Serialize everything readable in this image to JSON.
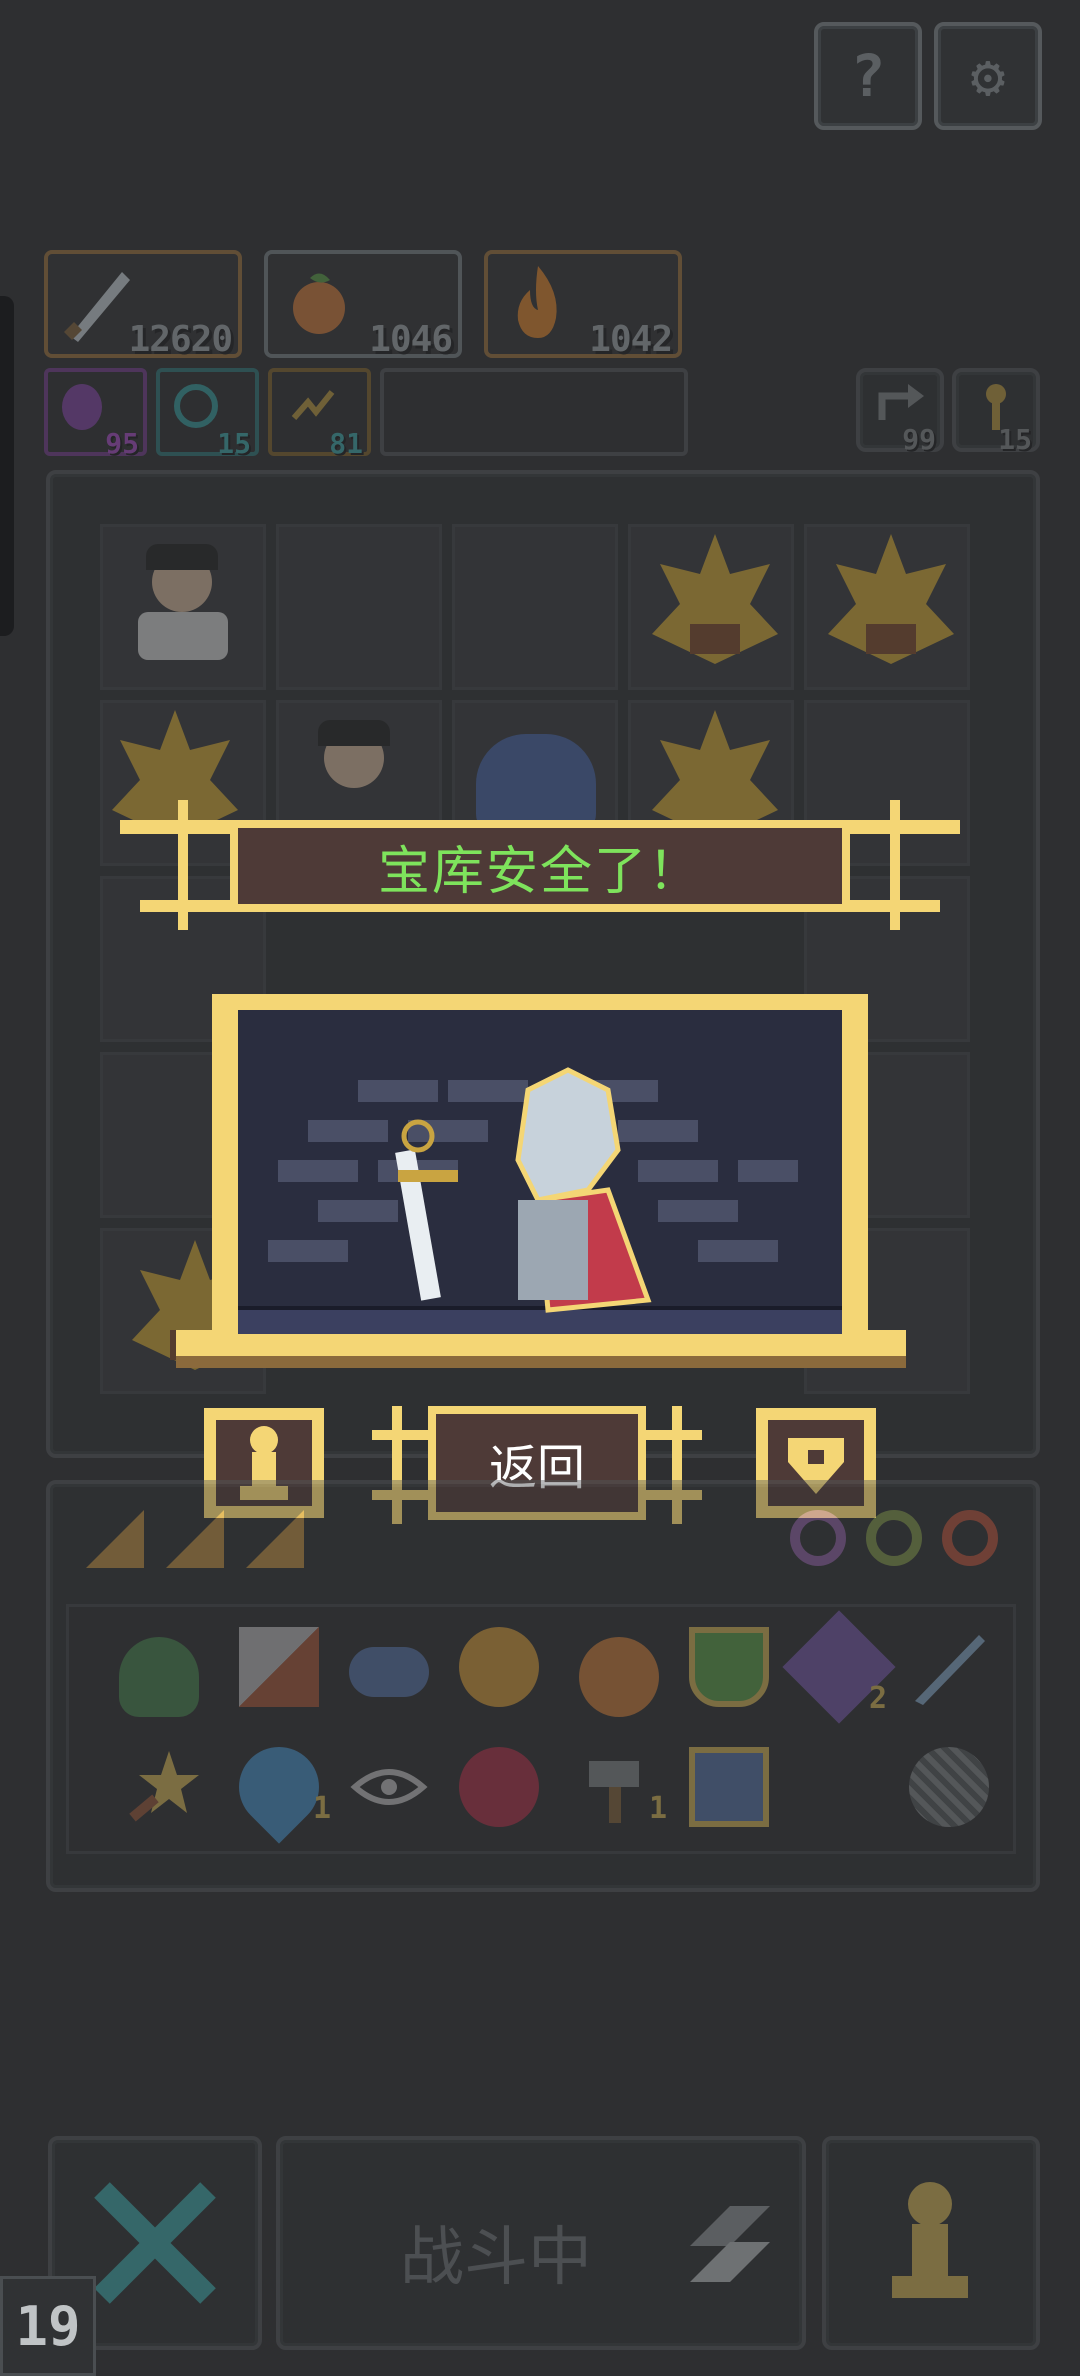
{
  "top_buttons": [
    {
      "name": "help",
      "glyph": "?"
    },
    {
      "name": "settings",
      "glyph": "⚙"
    }
  ],
  "resources": [
    {
      "name": "sword-power",
      "value": "12620",
      "color": "#a7793f"
    },
    {
      "name": "fruit-food",
      "value": "1046",
      "color": "#7f8a8f"
    },
    {
      "name": "fire-energy",
      "value": "1042",
      "color": "#a7793f"
    }
  ],
  "mini_resources": [
    {
      "name": "purple-orb",
      "value": "95",
      "color": "#7b3e96",
      "text": "#b34fd6"
    },
    {
      "name": "teal-spiral",
      "value": "15",
      "color": "#2f7e80",
      "text": "#3fb6b7"
    },
    {
      "name": "lightning",
      "value": "81",
      "color": "#8a6a2c",
      "text": "#3fb6b7"
    }
  ],
  "counters": [
    {
      "name": "return-arrow",
      "value": "99"
    },
    {
      "name": "key",
      "value": "15"
    }
  ],
  "dialog": {
    "title": "宝库安全了！",
    "back_label": "返回"
  },
  "inventory_counts": {
    "trident": "2",
    "water-drop": "1",
    "hammer": "1"
  },
  "battle": {
    "status_label": "战斗中"
  },
  "corner_counter": "19"
}
